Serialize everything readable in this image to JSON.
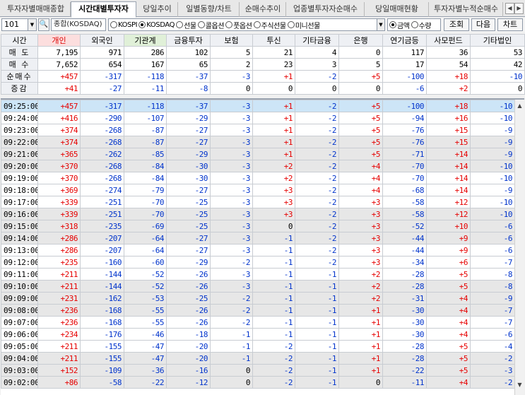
{
  "tabs": [
    "투자자별매매종합",
    "시간대별투자자",
    "당일추이",
    "일별동향/차트",
    "순매수추이",
    "업종별투자자순매수",
    "당일매매현황",
    "투자자별누적순매수"
  ],
  "active_tab": 1,
  "toolbar": {
    "code": "101",
    "name": "종합(KOSDAQ)",
    "markets": [
      {
        "label": "KOSPI",
        "on": false
      },
      {
        "label": "KOSDAQ",
        "on": true
      },
      {
        "label": "선물",
        "on": false
      },
      {
        "label": "콜옵션",
        "on": false
      },
      {
        "label": "풋옵션",
        "on": false
      },
      {
        "label": "주식선물",
        "on": false
      },
      {
        "label": "미니선물",
        "on": false
      }
    ],
    "units": [
      {
        "label": "금액",
        "on": true
      },
      {
        "label": "수량",
        "on": false
      }
    ],
    "query_label": "조회",
    "next_label": "다음",
    "chart_label": "차트"
  },
  "columns": [
    "시간",
    "개인",
    "외국인",
    "기관계",
    "금융투자",
    "보험",
    "투신",
    "기타금융",
    "은행",
    "연기금등",
    "사모펀드",
    "기타법인"
  ],
  "summary": [
    {
      "label": "매 도",
      "values": [
        "7,195",
        "971",
        "286",
        "102",
        "5",
        "21",
        "4",
        "0",
        "117",
        "36",
        "53"
      ]
    },
    {
      "label": "매 수",
      "values": [
        "7,652",
        "654",
        "167",
        "65",
        "2",
        "23",
        "3",
        "5",
        "17",
        "54",
        "42"
      ]
    },
    {
      "label": "순매수",
      "values": [
        "+457",
        "-317",
        "-118",
        "-37",
        "-3",
        "+1",
        "-2",
        "+5",
        "-100",
        "+18",
        "-10"
      ]
    },
    {
      "label": "증감",
      "values": [
        "+41",
        "-27",
        "-11",
        "-8",
        "0",
        "0",
        "0",
        "0",
        "-6",
        "+2",
        "0"
      ]
    }
  ],
  "rows": [
    {
      "time": "09:25:00",
      "values": [
        "+457",
        "-317",
        "-118",
        "-37",
        "-3",
        "+1",
        "-2",
        "+5",
        "-100",
        "+18",
        "-10"
      ]
    },
    {
      "time": "09:24:00",
      "values": [
        "+416",
        "-290",
        "-107",
        "-29",
        "-3",
        "+1",
        "-2",
        "+5",
        "-94",
        "+16",
        "-10"
      ]
    },
    {
      "time": "09:23:00",
      "values": [
        "+374",
        "-268",
        "-87",
        "-27",
        "-3",
        "+1",
        "-2",
        "+5",
        "-76",
        "+15",
        "-9"
      ]
    },
    {
      "time": "09:22:00",
      "values": [
        "+374",
        "-268",
        "-87",
        "-27",
        "-3",
        "+1",
        "-2",
        "+5",
        "-76",
        "+15",
        "-9"
      ]
    },
    {
      "time": "09:21:00",
      "values": [
        "+365",
        "-262",
        "-85",
        "-29",
        "-3",
        "+1",
        "-2",
        "+5",
        "-71",
        "+14",
        "-9"
      ]
    },
    {
      "time": "09:20:00",
      "values": [
        "+370",
        "-268",
        "-84",
        "-30",
        "-3",
        "+2",
        "-2",
        "+4",
        "-70",
        "+14",
        "-10"
      ]
    },
    {
      "time": "09:19:00",
      "values": [
        "+370",
        "-268",
        "-84",
        "-30",
        "-3",
        "+2",
        "-2",
        "+4",
        "-70",
        "+14",
        "-10"
      ]
    },
    {
      "time": "09:18:00",
      "values": [
        "+369",
        "-274",
        "-79",
        "-27",
        "-3",
        "+3",
        "-2",
        "+4",
        "-68",
        "+14",
        "-9"
      ]
    },
    {
      "time": "09:17:00",
      "values": [
        "+339",
        "-251",
        "-70",
        "-25",
        "-3",
        "+3",
        "-2",
        "+3",
        "-58",
        "+12",
        "-10"
      ]
    },
    {
      "time": "09:16:00",
      "values": [
        "+339",
        "-251",
        "-70",
        "-25",
        "-3",
        "+3",
        "-2",
        "+3",
        "-58",
        "+12",
        "-10"
      ]
    },
    {
      "time": "09:15:00",
      "values": [
        "+318",
        "-235",
        "-69",
        "-25",
        "-3",
        "0",
        "-2",
        "+3",
        "-52",
        "+10",
        "-6"
      ]
    },
    {
      "time": "09:14:00",
      "values": [
        "+286",
        "-207",
        "-64",
        "-27",
        "-3",
        "-1",
        "-2",
        "+3",
        "-44",
        "+9",
        "-6"
      ]
    },
    {
      "time": "09:13:00",
      "values": [
        "+286",
        "-207",
        "-64",
        "-27",
        "-3",
        "-1",
        "-2",
        "+3",
        "-44",
        "+9",
        "-6"
      ]
    },
    {
      "time": "09:12:00",
      "values": [
        "+235",
        "-160",
        "-60",
        "-29",
        "-2",
        "-1",
        "-2",
        "+3",
        "-34",
        "+6",
        "-7"
      ]
    },
    {
      "time": "09:11:00",
      "values": [
        "+211",
        "-144",
        "-52",
        "-26",
        "-3",
        "-1",
        "-1",
        "+2",
        "-28",
        "+5",
        "-8"
      ]
    },
    {
      "time": "09:10:00",
      "values": [
        "+211",
        "-144",
        "-52",
        "-26",
        "-3",
        "-1",
        "-1",
        "+2",
        "-28",
        "+5",
        "-8"
      ]
    },
    {
      "time": "09:09:00",
      "values": [
        "+231",
        "-162",
        "-53",
        "-25",
        "-2",
        "-1",
        "-1",
        "+2",
        "-31",
        "+4",
        "-9"
      ]
    },
    {
      "time": "09:08:00",
      "values": [
        "+236",
        "-168",
        "-55",
        "-26",
        "-2",
        "-1",
        "-1",
        "+1",
        "-30",
        "+4",
        "-7"
      ]
    },
    {
      "time": "09:07:00",
      "values": [
        "+236",
        "-168",
        "-55",
        "-26",
        "-2",
        "-1",
        "-1",
        "+1",
        "-30",
        "+4",
        "-7"
      ]
    },
    {
      "time": "09:06:00",
      "values": [
        "+234",
        "-176",
        "-46",
        "-18",
        "-1",
        "-1",
        "-1",
        "+1",
        "-30",
        "+4",
        "-6"
      ]
    },
    {
      "time": "09:05:00",
      "values": [
        "+211",
        "-155",
        "-47",
        "-20",
        "-1",
        "-2",
        "-1",
        "+1",
        "-28",
        "+5",
        "-4"
      ]
    },
    {
      "time": "09:04:00",
      "values": [
        "+211",
        "-155",
        "-47",
        "-20",
        "-1",
        "-2",
        "-1",
        "+1",
        "-28",
        "+5",
        "-2"
      ]
    },
    {
      "time": "09:03:00",
      "values": [
        "+152",
        "-109",
        "-36",
        "-16",
        "0",
        "-2",
        "-1",
        "+1",
        "-22",
        "+5",
        "-3"
      ]
    },
    {
      "time": "09:02:00",
      "values": [
        "+86",
        "-58",
        "-22",
        "-12",
        "0",
        "-2",
        "-1",
        "0",
        "-11",
        "+4",
        "-2"
      ]
    }
  ],
  "colors": {
    "positive": "#e60000",
    "negative": "#0033cc",
    "selected_row": "#cde5f7",
    "alt_row": "#e7e7e7",
    "header": "#eef0f4"
  }
}
